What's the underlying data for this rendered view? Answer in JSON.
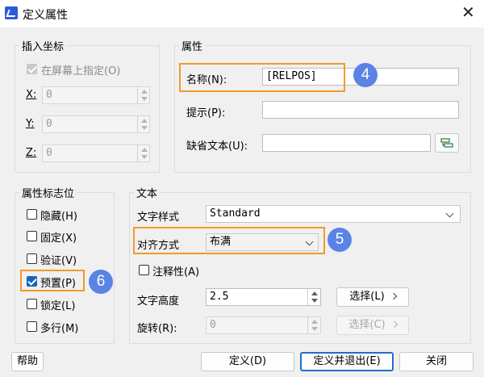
{
  "window": {
    "title": "定义属性",
    "close_glyph": "✕"
  },
  "insert_point": {
    "legend": "插入坐标",
    "on_screen_label": "在屏幕上指定(O)",
    "on_screen_checked": true,
    "x_label": "X:",
    "x_value": "0",
    "y_label": "Y:",
    "y_value": "0",
    "z_label": "Z:",
    "z_value": "0"
  },
  "attribute": {
    "legend": "属性",
    "name_label": "名称(N):",
    "name_value": "[RELPOS]",
    "prompt_label": "提示(P):",
    "prompt_value": "",
    "default_label": "缺省文本(U):",
    "default_value": "",
    "insert_field_icon": "insert-field-icon"
  },
  "flags": {
    "legend": "属性标志位",
    "items": [
      {
        "label": "隐藏(H)",
        "checked": false
      },
      {
        "label": "固定(X)",
        "checked": false
      },
      {
        "label": "验证(V)",
        "checked": false
      },
      {
        "label": "预置(P)",
        "checked": true
      },
      {
        "label": "锁定(L)",
        "checked": false
      },
      {
        "label": "多行(M)",
        "checked": false
      }
    ]
  },
  "text": {
    "legend": "文本",
    "style_label": "文字样式",
    "style_value": "Standard",
    "justify_label": "对齐方式",
    "justify_value": "布满",
    "annotative_label": "注释性(A)",
    "annotative_checked": false,
    "height_label": "文字高度",
    "height_value": "2.5",
    "height_pick_label": "选择(L)",
    "rotation_label": "旋转(R):",
    "rotation_value": "0",
    "rotation_pick_label": "选择(C)"
  },
  "buttons": {
    "help": "帮助",
    "define": "定义(D)",
    "define_exit": "定义并退出(E)",
    "close": "关闭"
  },
  "annotations": {
    "badge_4": "4",
    "badge_5": "5",
    "badge_6": "6"
  },
  "colors": {
    "accent_blue": "#1565c0",
    "highlight_orange": "#f39a2a",
    "badge_blue": "#5b83e6"
  }
}
